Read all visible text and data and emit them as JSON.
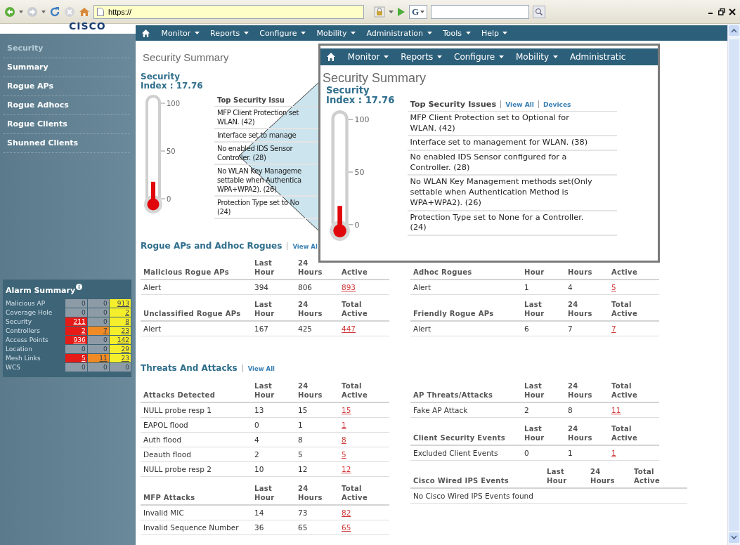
{
  "browser": {
    "address": "https://",
    "search_engine": "G"
  },
  "logo": "CISCO",
  "nav": [
    {
      "label": "Monitor",
      "caret": true
    },
    {
      "label": "Reports",
      "caret": true
    },
    {
      "label": "Configure",
      "caret": true
    },
    {
      "label": "Mobility",
      "caret": true
    },
    {
      "label": "Administration",
      "caret": true
    },
    {
      "label": "Tools",
      "caret": true
    },
    {
      "label": "Help",
      "caret": true
    }
  ],
  "sidebar": {
    "heading": "Security",
    "items": [
      "Summary",
      "Rogue APs",
      "Rogue Adhocs",
      "Rogue Clients",
      "Shunned Clients"
    ]
  },
  "alarm_summary": {
    "title": "Alarm Summary",
    "rows": [
      {
        "name": "Malicious AP",
        "cells": [
          {
            "value": "0",
            "color": "#8d9ba6",
            "link": false
          },
          {
            "value": "0",
            "color": "#8d9ba6",
            "link": false
          },
          {
            "value": "913",
            "color": "#f5ee2a",
            "link": true
          }
        ]
      },
      {
        "name": "Coverage Hole",
        "cells": [
          {
            "value": "0",
            "color": "#8d9ba6",
            "link": false
          },
          {
            "value": "0",
            "color": "#8d9ba6",
            "link": false
          },
          {
            "value": "2",
            "color": "#f5ee2a",
            "link": true
          }
        ]
      },
      {
        "name": "Security",
        "cells": [
          {
            "value": "211",
            "color": "#e41b17",
            "link": true
          },
          {
            "value": "0",
            "color": "#8d9ba6",
            "link": false
          },
          {
            "value": "8",
            "color": "#f5ee2a",
            "link": true
          }
        ]
      },
      {
        "name": "Controllers",
        "cells": [
          {
            "value": "2",
            "color": "#e41b17",
            "link": true
          },
          {
            "value": "7",
            "color": "#f08a24",
            "link": true
          },
          {
            "value": "23",
            "color": "#f5ee2a",
            "link": true
          }
        ]
      },
      {
        "name": "Access Points",
        "cells": [
          {
            "value": "936",
            "color": "#e41b17",
            "link": true
          },
          {
            "value": "0",
            "color": "#8d9ba6",
            "link": false
          },
          {
            "value": "142",
            "color": "#f5ee2a",
            "link": true
          }
        ]
      },
      {
        "name": "Location",
        "cells": [
          {
            "value": "0",
            "color": "#8d9ba6",
            "link": false
          },
          {
            "value": "0",
            "color": "#8d9ba6",
            "link": false
          },
          {
            "value": "29",
            "color": "#f5ee2a",
            "link": true
          }
        ]
      },
      {
        "name": "Mesh Links",
        "cells": [
          {
            "value": "5",
            "color": "#e41b17",
            "link": true
          },
          {
            "value": "11",
            "color": "#f08a24",
            "link": true
          },
          {
            "value": "23",
            "color": "#f5ee2a",
            "link": true
          }
        ]
      },
      {
        "name": "WCS",
        "cells": [
          {
            "value": "0",
            "color": "#8d9ba6",
            "link": false
          },
          {
            "value": "0",
            "color": "#8d9ba6",
            "link": false
          },
          {
            "value": "0",
            "color": "#8d9ba6",
            "link": false
          }
        ]
      }
    ]
  },
  "page_title": "Security Summary",
  "security_index": {
    "label": "Security\nIndex : 17.76",
    "level": 0.1776,
    "ticks": [
      "100",
      "50",
      "0"
    ]
  },
  "top_issues": {
    "title": "Top Security Issu",
    "items": [
      "MFP Client Protection set\nWLAN. (42)",
      "Interface set to manage",
      "No enabled IDS Sensor\nController. (28)",
      "No WLAN Key Manageme\nsettable when Authentica\nWPA+WPA2). (26)",
      "Protection Type set to No\n(24)"
    ]
  },
  "rogue_section": {
    "title": "Rogue APs and Adhoc Rogues",
    "link": "View Al",
    "left_tables": [
      {
        "columns": [
          "Malicious Rogue APs",
          "Last\nHour",
          "24\nHours",
          "Active"
        ],
        "rows": [
          [
            "Alert",
            "394",
            "806",
            "893"
          ]
        ]
      },
      {
        "columns": [
          "Unclassified Rogue APs",
          "Last\nHour",
          "24\nHours",
          "Total\nActive"
        ],
        "rows": [
          [
            "Alert",
            "167",
            "425",
            "447"
          ]
        ]
      }
    ],
    "right_tables": [
      {
        "columns": [
          "Adhoc Rogues",
          "Hour",
          "Hours",
          "Active"
        ],
        "rows": [
          [
            "Alert",
            "1",
            "4",
            "5"
          ]
        ]
      },
      {
        "columns": [
          "Friendly Rogue APs",
          "Last\nHour",
          "24\nHours",
          "Total\nActive"
        ],
        "rows": [
          [
            "Alert",
            "6",
            "7",
            "7"
          ]
        ]
      }
    ]
  },
  "threats_section": {
    "title": "Threats And Attacks",
    "link": "View All",
    "left_tables": [
      {
        "columns": [
          "Attacks Detected",
          "Last\nHour",
          "24\nHours",
          "Total\nActive"
        ],
        "rows": [
          [
            "NULL probe resp 1",
            "13",
            "15",
            "15"
          ],
          [
            "EAPOL flood",
            "0",
            "1",
            "1"
          ],
          [
            "Auth flood",
            "4",
            "8",
            "8"
          ],
          [
            "Deauth flood",
            "2",
            "5",
            "5"
          ],
          [
            "NULL probe resp 2",
            "10",
            "12",
            "12"
          ]
        ]
      },
      {
        "columns": [
          "MFP Attacks",
          "Last\nHour",
          "24\nHours",
          "Total\nActive"
        ],
        "rows": [
          [
            "Invalid MIC",
            "14",
            "73",
            "82"
          ],
          [
            "Invalid Sequence Number",
            "36",
            "65",
            "65"
          ]
        ]
      }
    ],
    "right_tables": [
      {
        "columns": [
          "AP Threats/Attacks",
          "Last\nHour",
          "24\nHours",
          "Total\nActive"
        ],
        "rows": [
          [
            "Fake AP Attack",
            "2",
            "8",
            "11"
          ]
        ]
      },
      {
        "columns": [
          "Client Security Events",
          "Last\nHour",
          "24\nHours",
          "Total\nActive"
        ],
        "rows": [
          [
            "Excluded Client Events",
            "0",
            "1",
            "1"
          ]
        ]
      },
      {
        "columns": [
          "Cisco Wired IPS Events",
          "Last\nHour",
          "24\nHours",
          "Total\nActive"
        ],
        "rows": [
          [
            "No Cisco Wired IPS Events found"
          ]
        ]
      }
    ]
  },
  "callout": {
    "nav": [
      {
        "label": "Monitor",
        "caret": true
      },
      {
        "label": "Reports",
        "caret": true
      },
      {
        "label": "Configure",
        "caret": true
      },
      {
        "label": "Mobility",
        "caret": true
      },
      {
        "label": "Administratic",
        "caret": false
      }
    ],
    "page_title": "Security Summary",
    "security_index": {
      "label": "Security\nIndex : 17.76",
      "level": 0.1776,
      "ticks": [
        "100",
        "50",
        "0"
      ]
    },
    "top_issues": {
      "title": "Top Security Issues",
      "links": [
        "View All",
        "Devices"
      ],
      "items": [
        "MFP Client Protection set to Optional for\nWLAN. (42)",
        "Interface set to management for WLAN. (38)",
        "No enabled IDS Sensor configured for a\nController. (28)",
        "No WLAN Key Management methods set(Only\nsettable when Authentication Method is\nWPA+WPA2). (26)",
        "Protection Type set to None for a Controller.\n(24)"
      ]
    }
  }
}
